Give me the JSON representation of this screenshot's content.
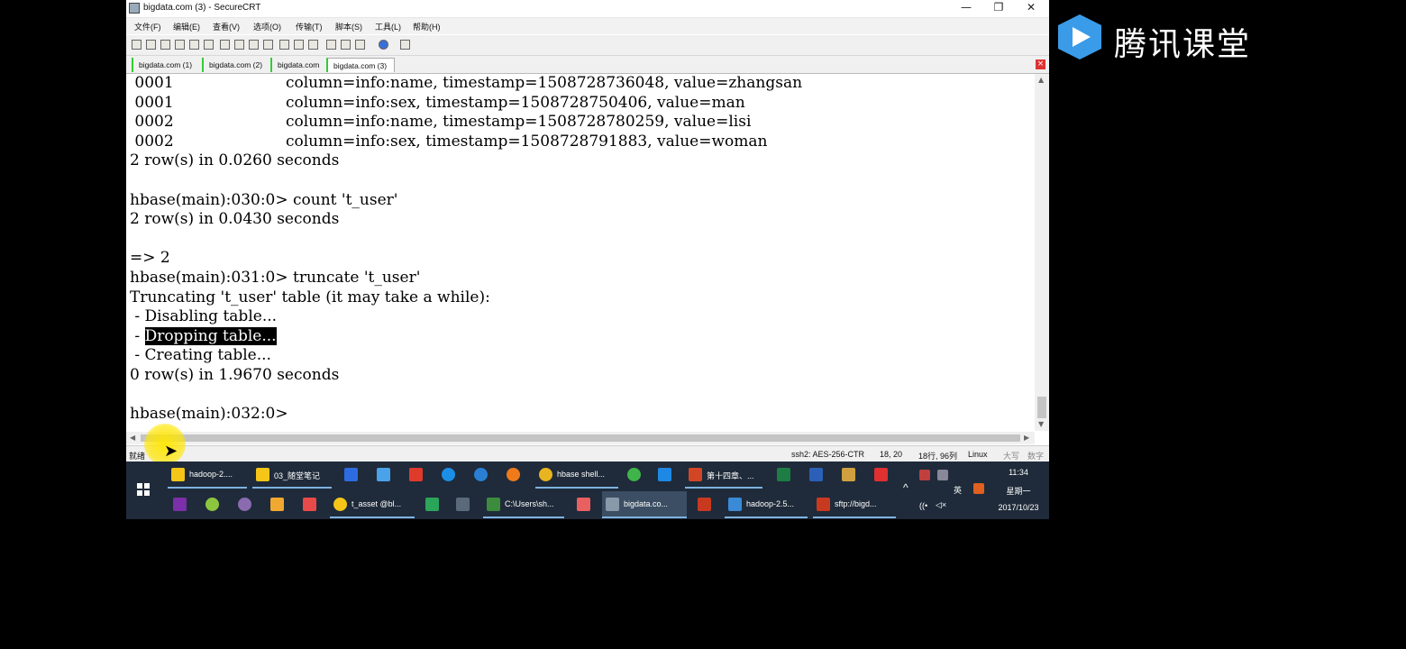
{
  "window": {
    "title": "bigdata.com (3) - SecureCRT",
    "minimize": "—",
    "restore": "❐",
    "close": "✕"
  },
  "menu": [
    "文件(F)",
    "编辑(E)",
    "查看(V)",
    "选项(O)",
    "传输(T)",
    "脚本(S)",
    "工具(L)",
    "帮助(H)"
  ],
  "tabs": [
    {
      "label": "bigdata.com (1)"
    },
    {
      "label": "bigdata.com (2)"
    },
    {
      "label": "bigdata.com"
    },
    {
      "label": "bigdata.com (3)"
    }
  ],
  "tab_close": "×",
  "terminal": {
    "lines": [
      " 0001                       column=info:name, timestamp=1508728736048, value=zhangsan",
      " 0001                       column=info:sex, timestamp=1508728750406, value=man",
      " 0002                       column=info:name, timestamp=1508728780259, value=lisi",
      " 0002                       column=info:sex, timestamp=1508728791883, value=woman",
      "2 row(s) in 0.0260 seconds",
      "",
      "hbase(main):030:0> count 't_user'",
      "2 row(s) in 0.0430 seconds",
      "",
      "=> 2",
      "hbase(main):031:0> truncate 't_user'",
      "Truncating 't_user' table (it may take a while):",
      " - Disabling table...",
      "",
      " - Creating table...",
      "0 row(s) in 1.9670 seconds",
      "",
      "hbase(main):032:0>"
    ],
    "highlight_prefix": " - ",
    "highlight_text": "Dropping table..."
  },
  "status": {
    "left": "就绪",
    "ssh": "ssh2: AES-256-CTR",
    "pos": "18,  20",
    "size": "18行, 96列",
    "os": "Linux",
    "caps": "大写",
    "num": "数字"
  },
  "taskbar": {
    "row1": [
      {
        "label": "hadoop-2....",
        "color": "#f5c518"
      },
      {
        "label": "03_随堂笔记",
        "color": "#f5c518"
      },
      {
        "label": "",
        "color": "#2d6be0"
      },
      {
        "label": "",
        "color": "#4aa3e8"
      },
      {
        "label": "",
        "color": "#e03a2b"
      },
      {
        "label": "",
        "color": "#1b8fe6"
      },
      {
        "label": "",
        "color": "#2a7fd4"
      },
      {
        "label": "",
        "color": "#f07a1a"
      },
      {
        "label": "hbase shell...",
        "color": "#e8b420"
      },
      {
        "label": "",
        "color": "#3fb44a"
      },
      {
        "label": "",
        "color": "#1e88e5"
      },
      {
        "label": "第十四章、...",
        "color": "#d24625"
      },
      {
        "label": "",
        "color": "#1d7d44"
      },
      {
        "label": "",
        "color": "#2b5fb8"
      },
      {
        "label": "",
        "color": "#d0a040"
      },
      {
        "label": "",
        "color": "#e03030"
      }
    ],
    "row2": [
      {
        "label": "",
        "color": "#7b2fa8"
      },
      {
        "label": "",
        "color": "#8cc63f"
      },
      {
        "label": "",
        "color": "#8b6bb0"
      },
      {
        "label": "",
        "color": "#f0a830"
      },
      {
        "label": "",
        "color": "#e84a4a"
      },
      {
        "label": "t_asset @bl...",
        "color": "#f5c518"
      },
      {
        "label": "",
        "color": "#2aa55a"
      },
      {
        "label": "",
        "color": "#5a6a7a"
      },
      {
        "label": "C:\\Users\\sh...",
        "color": "#3d8b3d"
      },
      {
        "label": "",
        "color": "#e86060"
      },
      {
        "label": "bigdata.co...",
        "color": "#8899aa"
      },
      {
        "label": "",
        "color": "#c83a20"
      },
      {
        "label": "hadoop-2.5...",
        "color": "#3a8ad8"
      },
      {
        "label": "sftp://bigd...",
        "color": "#c83a20"
      }
    ],
    "tray_up": "^",
    "ime": "英",
    "wifi": "((•",
    "volume": "◁×",
    "time": "11:34",
    "weekday": "星期一",
    "date": "2017/10/23"
  },
  "brand": {
    "name": "腾讯课堂",
    "color": "#3a9be8"
  }
}
